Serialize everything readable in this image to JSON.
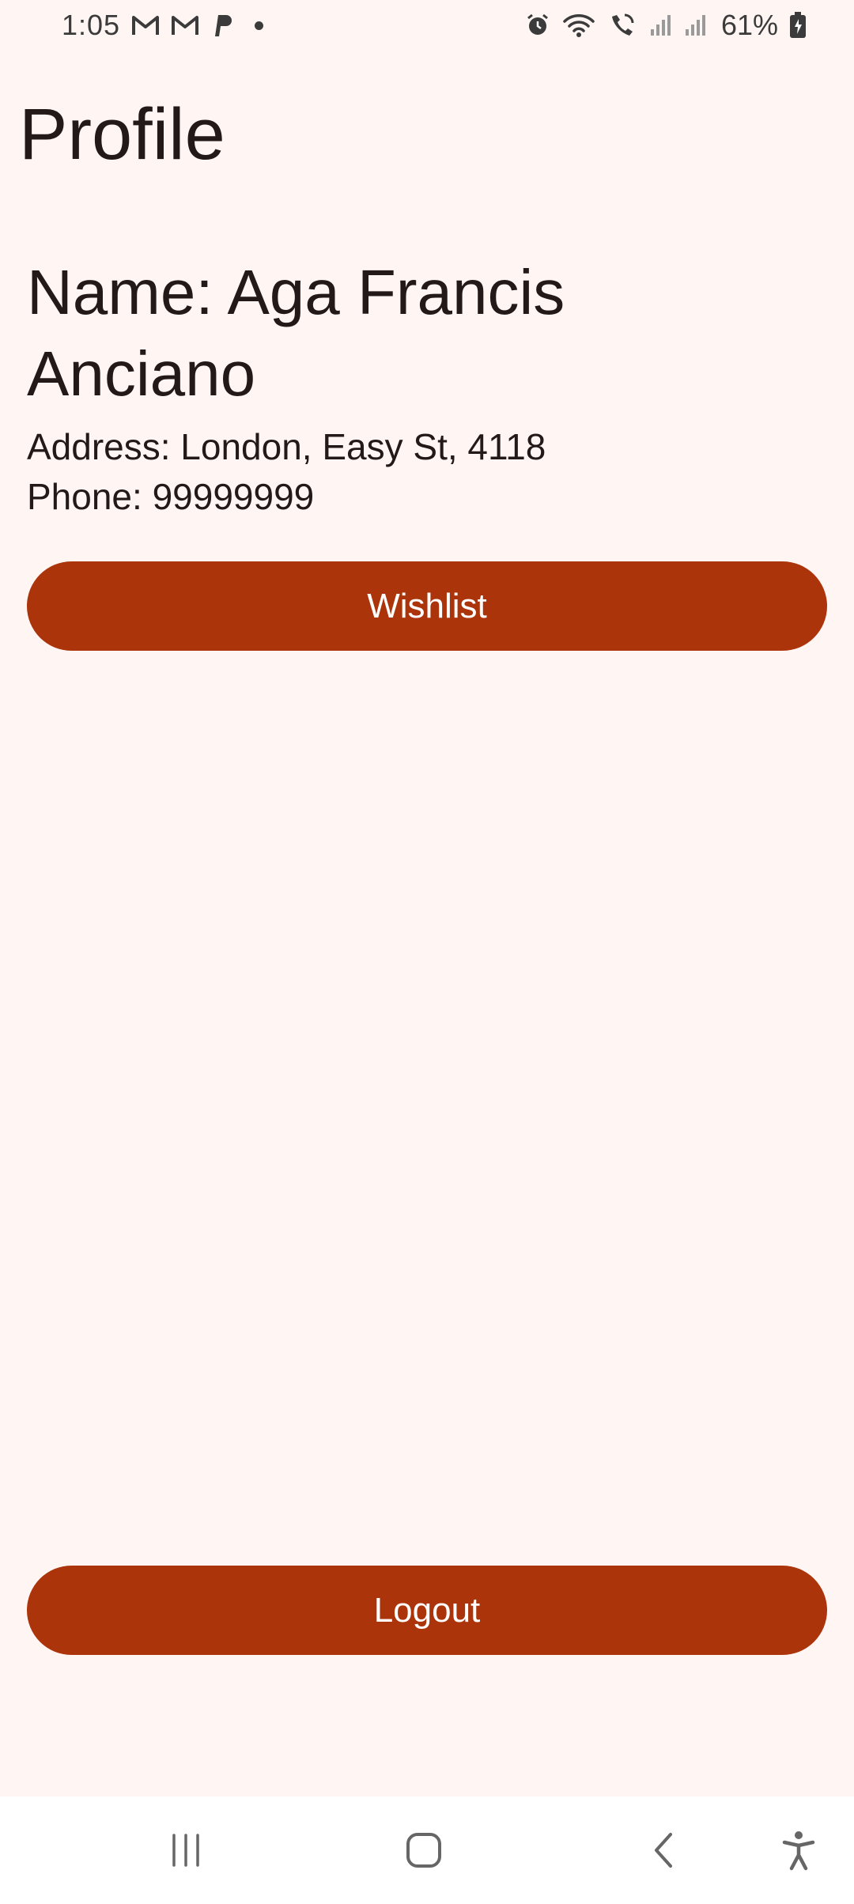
{
  "status_bar": {
    "time": "1:05",
    "battery": "61%",
    "left_icons": [
      "gmail-icon",
      "gmail-icon",
      "paypal-icon",
      "notification-dot"
    ],
    "right_icons": [
      "alarm-icon",
      "wifi-icon",
      "wifi-calling-icon",
      "signal-icon",
      "signal-icon",
      "battery-charging-icon"
    ]
  },
  "header": {
    "title": "Profile"
  },
  "profile": {
    "name": "Name: Aga Francis Anciano",
    "address": "Address: London, Easy St, 4118",
    "phone": "Phone: 99999999"
  },
  "actions": {
    "wishlist_label": "Wishlist",
    "logout_label": "Logout"
  },
  "colors": {
    "background": "#FFF6F4",
    "button": "#AC340B",
    "button_text": "#FFFFFF",
    "text": "#231918"
  },
  "nav_bar": {
    "icons": [
      "recents-icon",
      "home-icon",
      "back-icon",
      "accessibility-icon"
    ]
  }
}
